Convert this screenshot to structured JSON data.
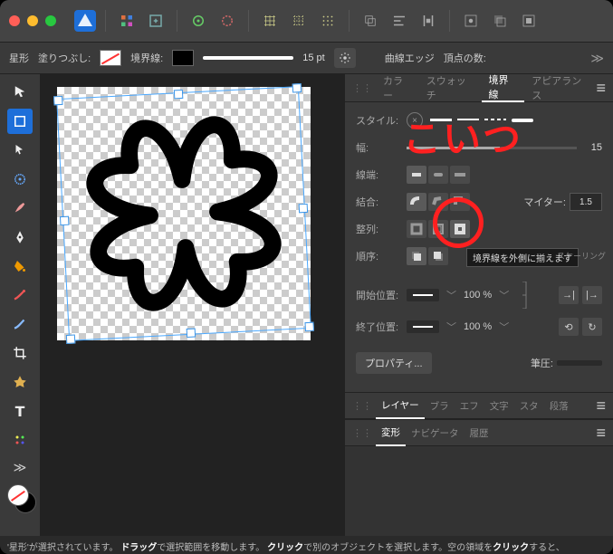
{
  "titlebar": {
    "app": "Affinity Designer"
  },
  "contextbar": {
    "shape": "星形",
    "fill_label": "塗りつぶし:",
    "stroke_label": "境界線:",
    "width_value": "15 pt",
    "curve_edge": "曲線エッジ",
    "vertex_count": "頂点の数:"
  },
  "panel_tabs": {
    "color": "カラー",
    "swatch": "スウォッチ",
    "stroke": "境界線",
    "appearance": "アピアランス"
  },
  "stroke_panel": {
    "style": "スタイル:",
    "width": "幅:",
    "width_val": "15",
    "cap": "線端:",
    "join": "結合:",
    "miter": "マイター:",
    "miter_val": "1.5",
    "align": "整列:",
    "order": "順序:",
    "tooltip_align_outside": "境界線を外側に揃えます",
    "scaling_suffix": "スケーリング",
    "start": "開始位置:",
    "end": "終了位置:",
    "pct_100": "100 %",
    "properties_btn": "プロパティ...",
    "pen_pressure": "筆圧:"
  },
  "lower_tab_rows": {
    "row1": [
      "レイヤー",
      "ブラ",
      "エフ",
      "文字",
      "スタ",
      "段落"
    ],
    "row2": [
      "変形",
      "ナビゲータ",
      "履歴"
    ]
  },
  "status": {
    "seg1": "'星形'が選択されています。",
    "seg2_b": "ドラッグ",
    "seg2": "で選択範囲を移動します。",
    "seg3_b": "クリック",
    "seg3": "で別のオブジェクトを選択します。空の領域を",
    "seg4_b": "クリック",
    "seg4": "すると、"
  },
  "annotation": {
    "text": "こいつ",
    "circle_target": "align-outside-option"
  }
}
